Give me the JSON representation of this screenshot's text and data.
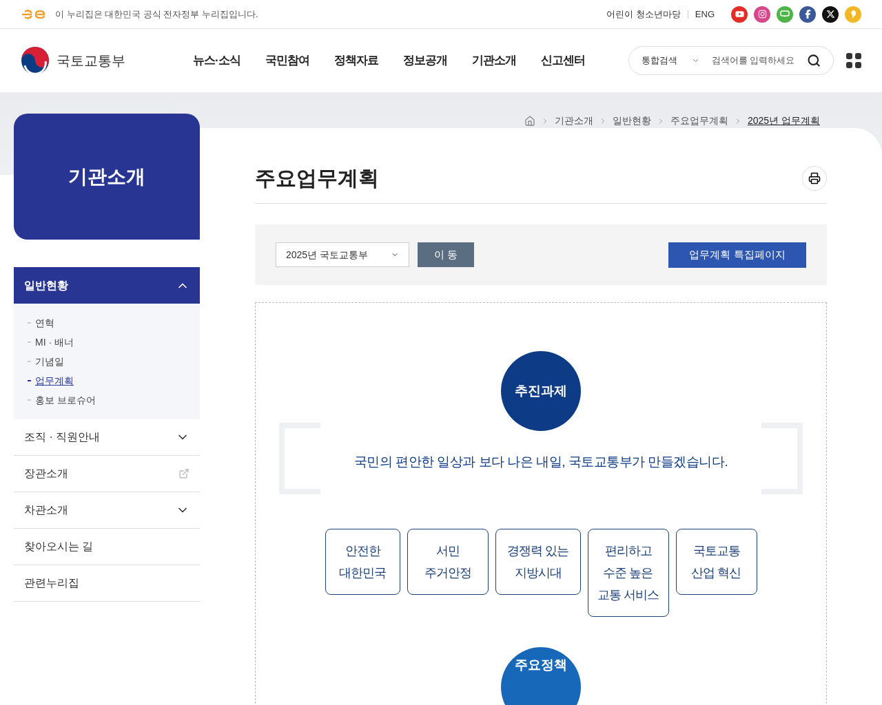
{
  "top_bar": {
    "notice": "이 누리집은 대한민국 공식 전자정부 누리집입니다.",
    "links": [
      "어린이 청소년마당",
      "ENG"
    ]
  },
  "header": {
    "logo": "국토교통부",
    "nav": [
      "뉴스·소식",
      "국민참여",
      "정책자료",
      "정보공개",
      "기관소개",
      "신고센터"
    ],
    "search": {
      "scope": "통합검색",
      "placeholder": "검색어를 입력하세요"
    }
  },
  "sidebar": {
    "title": "기관소개",
    "items": [
      {
        "label": "일반현황",
        "kind": "accordion",
        "expanded": true,
        "children": [
          {
            "label": "연혁",
            "selected": false
          },
          {
            "label": "MI · 배너",
            "selected": false
          },
          {
            "label": "기념일",
            "selected": false
          },
          {
            "label": "업무계획",
            "selected": true
          },
          {
            "label": "홍보 브로슈어",
            "selected": false
          }
        ]
      },
      {
        "label": "조직 · 직원안내",
        "kind": "accordion",
        "expanded": false
      },
      {
        "label": "장관소개",
        "kind": "external"
      },
      {
        "label": "차관소개",
        "kind": "accordion",
        "expanded": false
      },
      {
        "label": "찾아오시는 길",
        "kind": "plain"
      },
      {
        "label": "관련누리집",
        "kind": "plain"
      }
    ]
  },
  "breadcrumb": [
    "기관소개",
    "일반현황",
    "주요업무계획",
    "2025년 업무계획"
  ],
  "page_title": "주요업무계획",
  "filter": {
    "select": "2025년 국토교통부",
    "go_button": "이 동",
    "special_button": "업무계획 특집페이지"
  },
  "diagram": {
    "top_circle": "추진과제",
    "slogan": "국민의 편안한 일상과 보다 나은 내일, 국토교통부가 만들겠습니다.",
    "tasks": [
      [
        "안전한",
        "대한민국"
      ],
      [
        "서민",
        "주거안정"
      ],
      [
        "경쟁력 있는",
        "지방시대"
      ],
      [
        "편리하고",
        "수준 높은",
        "교통 서비스"
      ],
      [
        "국토교통",
        "산업 혁신"
      ]
    ],
    "bottom_circle": "주요정책"
  }
}
